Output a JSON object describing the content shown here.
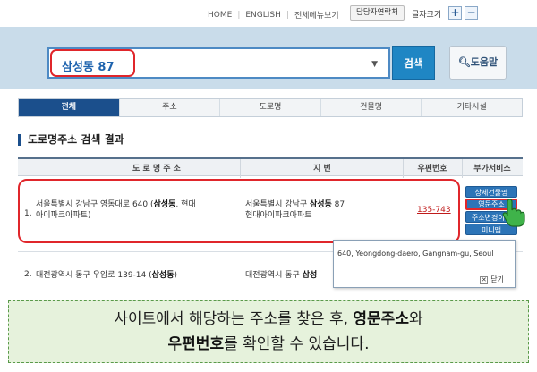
{
  "topnav": {
    "home": "HOME",
    "english": "ENGLISH",
    "all_menu": "전체메뉴보기",
    "contact": "담당자연락처",
    "font_size": "글자크기",
    "plus": "+",
    "minus": "−"
  },
  "search": {
    "value": "삼성동 87",
    "button": "검색",
    "help": "도움말"
  },
  "tabs": [
    "전체",
    "주소",
    "도로명",
    "건물명",
    "기타시설"
  ],
  "section_title": "도로명주소 검색 결과",
  "table": {
    "headers": [
      "도 로 명 주 소",
      "지 번",
      "우편번호",
      "부가서비스"
    ],
    "rows": [
      {
        "num": "1.",
        "road_pre": "서울특별시 강남구 영동대로 640 (",
        "road_bold": "삼성동",
        "road_post": ", 현대",
        "road_line2": "아이파크아파트)",
        "jibun_pre": "서울특별시 강남구 ",
        "jibun_bold": "삼성동",
        "jibun_post": " 87",
        "jibun_line2": "현대아이파크아파트",
        "postcode": "135-743"
      },
      {
        "num": "2.",
        "road_pre": "대전광역시 동구 우암로 139-14 (",
        "road_bold": "삼성동",
        "road_post": ")",
        "jibun_pre": "대전광역시 동구 ",
        "jibun_bold": "삼성"
      }
    ],
    "services": [
      "상세건물명",
      "영문주소",
      "주소변경이력",
      "미니맵"
    ]
  },
  "popup": {
    "english_address": "640, Yeongdong-daero, Gangnam-gu, Seoul",
    "close": "닫기"
  },
  "caption": {
    "line1_pre": "사이트에서 해당하는 주소를 찾은 후, ",
    "line1_bold": "영문주소",
    "line1_post": "와",
    "line2_bold": "우편번호",
    "line2_post": "를 확인할 수 있습니다."
  },
  "colors": {
    "accent_blue": "#1f86c4",
    "highlight_red": "#e0262b",
    "caption_bg": "#e6f2dc"
  }
}
